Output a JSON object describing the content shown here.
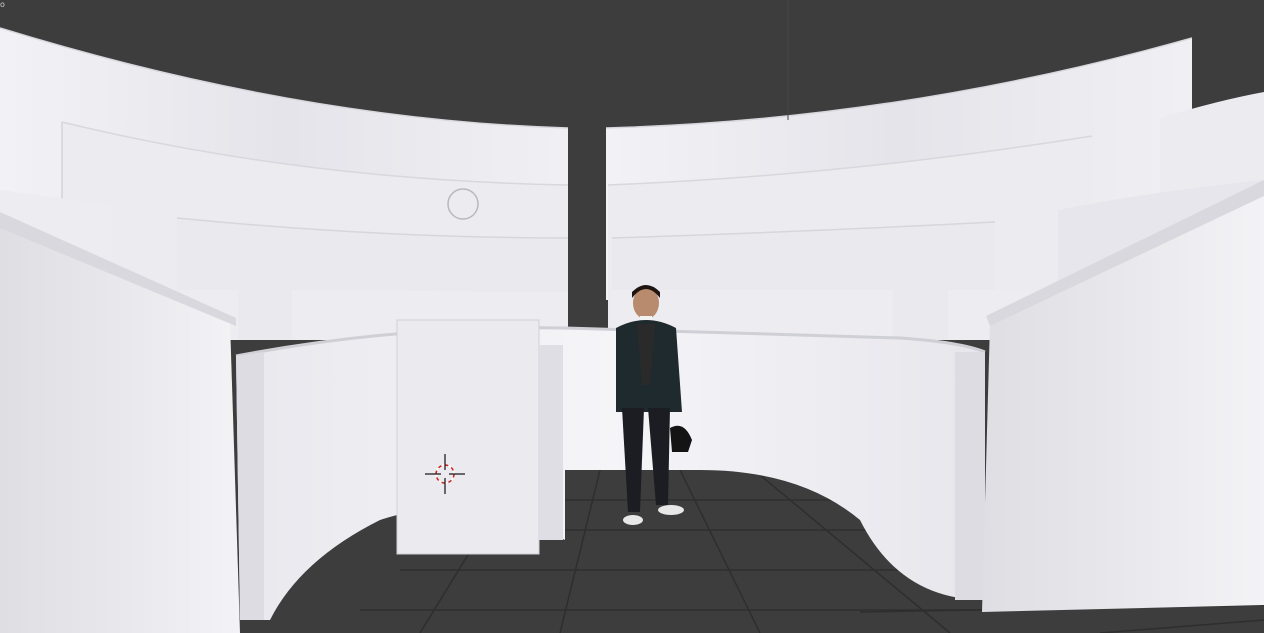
{
  "viewport": {
    "corner_label": "o",
    "background_color": "#3d3d3d",
    "grid_line_color": "#2e2e2e",
    "wall_color": "#e9e9ee",
    "cursor_color": "#cc2222"
  },
  "scene": {
    "objects": [
      {
        "name": "tier-back-left"
      },
      {
        "name": "tier-back-right"
      },
      {
        "name": "tier-mid-left"
      },
      {
        "name": "tier-mid-right"
      },
      {
        "name": "tier-low-left"
      },
      {
        "name": "tier-low-right"
      },
      {
        "name": "front-rail-curved"
      },
      {
        "name": "left-stair-wall"
      },
      {
        "name": "right-stair-wall"
      },
      {
        "name": "door-panel"
      },
      {
        "name": "person-cutout"
      }
    ]
  },
  "gizmos": {
    "view_center_marker": "circle-icon",
    "cursor_3d": "crosshair-icon"
  }
}
